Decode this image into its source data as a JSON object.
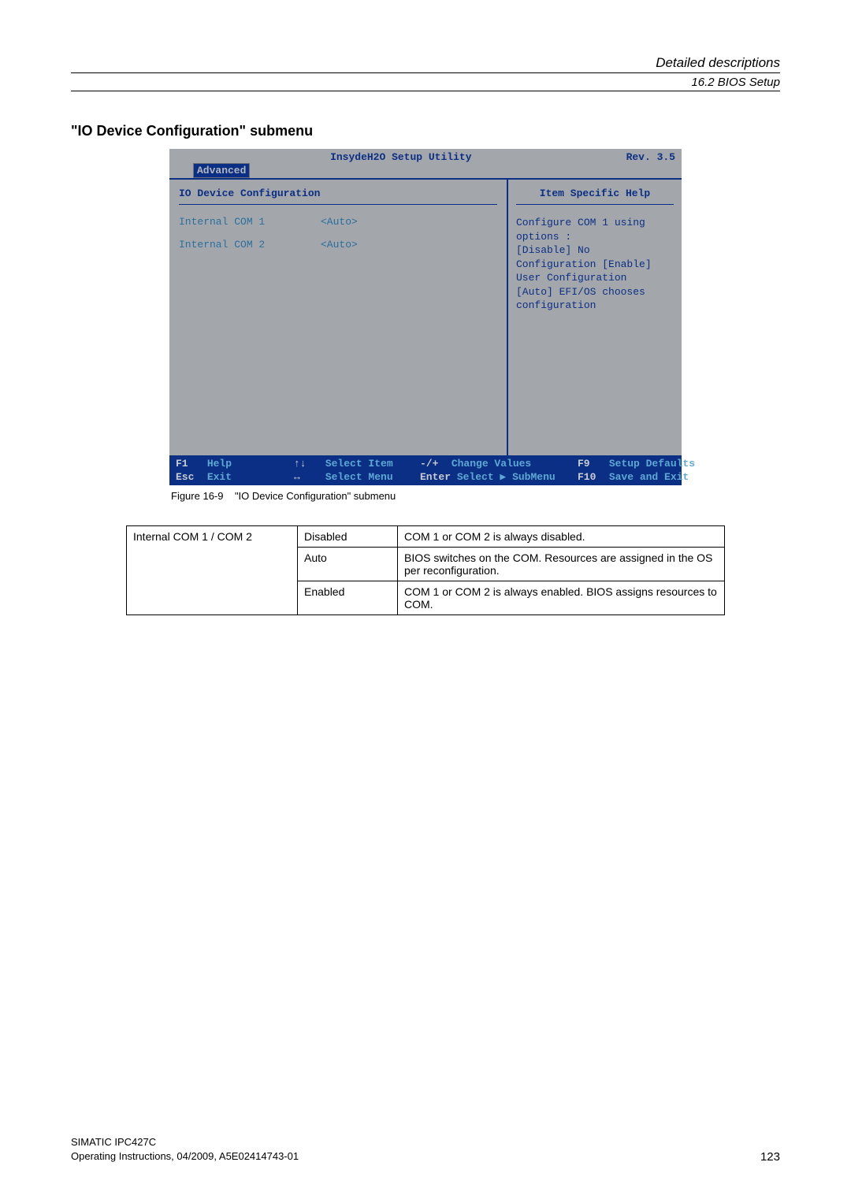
{
  "header": {
    "chapter": "Detailed descriptions",
    "section": "16.2 BIOS Setup"
  },
  "section_title": "\"IO Device Configuration\" submenu",
  "bios": {
    "top_title": "InsydeH2O Setup Utility",
    "top_rev": "Rev. 3.5",
    "tab": "Advanced",
    "pane_title": "IO Device Configuration",
    "help_title": "Item Specific Help",
    "items": [
      {
        "label": "Internal COM 1",
        "value": "<Auto>"
      },
      {
        "label": "Internal COM 2",
        "value": "<Auto>"
      }
    ],
    "help_lines": [
      "Configure COM 1 using",
      "options :",
      "[Disable] No",
      "Configuration [Enable]",
      "User Configuration",
      "[Auto] EFI/OS chooses",
      "configuration"
    ],
    "footer": {
      "f1_key": "F1",
      "f1_lbl": "Help",
      "updown_key": "↑↓",
      "updown_lbl": "Select Item",
      "pm_key": "-/+",
      "pm_lbl": "Change Values",
      "f9_key": "F9",
      "f9_lbl": "Setup Defaults",
      "esc_key": "Esc",
      "esc_lbl": "Exit",
      "lr_key": "↔",
      "lr_lbl": "Select Menu",
      "enter_key": "Enter",
      "enter_lbl": "Select ▶ SubMenu",
      "f10_key": "F10",
      "f10_lbl": "Save and Exit"
    }
  },
  "figure_caption": {
    "num": "Figure 16-9",
    "text": "\"IO Device Configuration\" submenu"
  },
  "param_table": {
    "col1": "Internal COM 1 / COM 2",
    "rows": [
      {
        "opt": "Disabled",
        "desc": "COM 1 or COM 2 is always disabled."
      },
      {
        "opt": "Auto",
        "desc": "BIOS switches on the COM. Resources are assigned in the OS per reconfiguration."
      },
      {
        "opt": "Enabled",
        "desc": "COM 1 or COM 2 is always enabled. BIOS assigns resources to COM."
      }
    ]
  },
  "footer": {
    "product": "SIMATIC IPC427C",
    "docinfo": "Operating Instructions, 04/2009, A5E02414743-01",
    "page": "123"
  }
}
